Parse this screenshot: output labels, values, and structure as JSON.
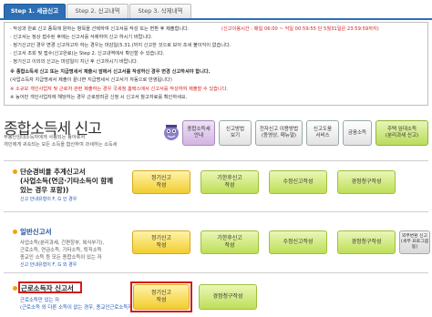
{
  "tabs": [
    "Step 1. 세금신고",
    "Step 2. 신고내역",
    "Step 3. 삭제내역"
  ],
  "notice": {
    "lines": [
      "· 작성과 완료 신고 종목에 원하는 항목을 선택하여 신고서를 작성 또는 변환 후 제출합니다.",
      "(신고이용시간 : 매일 06:00 ~ 익일 00:59:55 단 5월31일은 23:59:59까지)",
      "· 신고서는 정상 접수된 후에는 신고서를 삭제하여 신고 하시기 바랍니다.",
      "· 정기신고인 경우 변경 신고하고자 하는 경우는 마감일(5.31.)까지 신고한 것으로 보아 조세 불이익이 없습니다.",
      "· 신고서 조회 및 접수(신고완료)는 Step 2. 신고내역에서 확인할 수 있습니다.",
      "· 정기신고 이외의 신고는 마감일이 지난 후 신고하시기 바랍니다.",
      "※ 종합소득세 신고 또는 지급명세서 제출시 앞에서 신고서를 작성하신 경우 변경 신고하셔야 합니다.",
      "(사업소득자 지급명세서 제출이 끝나면 지급명세서 신고서가 자동으로 반영됩니다)",
      "※ 소규모 개인사업자 및 근로자 관련 제출하는 경우 국세청 홈택스에서 신고서를 작성하여 제출할 수 있습니다.",
      "※ 농어민 개인사업자에 해당하는 경우 근로장려금 신청 시 신고서 참고자료를 확인하세요."
    ],
    "red_note": "(신고이용시간 : 매일 06:00 ~ 익일 00:59:55 단 5월31일은 23:59:59까지)"
  },
  "page": {
    "title": "종합소득세 신고",
    "subtitle_lines": [
      "부동산임대소득자에게 사용되는 용어로서",
      "개인에게 귀속되는 모든 소득을 합산하여 과세하는 소득세"
    ]
  },
  "quick_buttons": [
    {
      "label": "종합소득세\n안내",
      "style": "purple"
    },
    {
      "label": "신고방법\n보기",
      "style": "plain"
    },
    {
      "label": "전자신고 이용방법\n(동영상, 매뉴얼)",
      "style": "plain"
    },
    {
      "label": "신고도움\n서비스",
      "style": "plain"
    },
    {
      "label": "금융소득",
      "style": "plain"
    },
    {
      "label": "주택 임대소득\n(분리과세 신고)",
      "style": "green"
    }
  ],
  "sections": [
    {
      "title": "단순경비율 추계신고서",
      "title_lines": [
        "단순경비율 추계신고서",
        "(사업소득(연금·기타소득이 함께",
        "있는 경우 포함))"
      ],
      "desc": [],
      "link": "신고 안내유형이 F, G 인 경우",
      "buttons": [
        "정기신고\n작성",
        "기한후신고\n작성",
        "수정신고작성",
        "경정청구작성"
      ]
    },
    {
      "title": "일반신고서",
      "title_lines": [
        "일반신고서"
      ],
      "desc": [
        "사업소득(분리과세, 간편장부, 복식부기),",
        "근로소득, 연금소득, 기타소득, 퇴직소득",
        "종교인 소득 등 모든 종합소득이 있는 자"
      ],
      "link": "신고 안내유형이 F, G 외 경우",
      "buttons": [
        "정기신고\n작성",
        "기한후신고\n작성",
        "수정신고작성",
        "경정청구작성",
        "외부변환 신고\n(세무 프로그램 등)"
      ]
    },
    {
      "title": "근로소득자 신고서",
      "title_lines": [
        "근로소득자 신고서"
      ],
      "desc": [
        "근로소득만 있는 자",
        "(근로소득 외 다른 소득이 없는 경우, 종교인근로소득자"
      ],
      "link": "",
      "buttons": [
        "정기신고\n작성",
        "경정청구작성"
      ]
    }
  ],
  "colors": {
    "tab_active": "#2d6fb5",
    "highlight": "#d31b1b",
    "accent_yellow": "#f2cd2f",
    "accent_green": "#bedf57"
  }
}
